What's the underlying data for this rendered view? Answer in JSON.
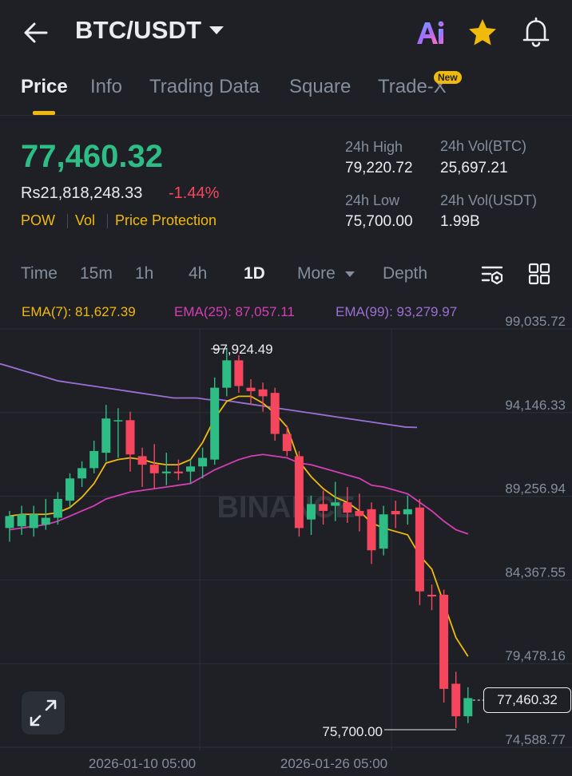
{
  "header": {
    "pair": "BTC/USDT",
    "icons": [
      "back-arrow-icon",
      "ai-icon",
      "star-icon",
      "bell-icon"
    ]
  },
  "tabs": [
    {
      "label": "Price",
      "active": true
    },
    {
      "label": "Info"
    },
    {
      "label": "Trading Data"
    },
    {
      "label": "Square"
    },
    {
      "label": "Trade-X",
      "badge": "New"
    }
  ],
  "ticker": {
    "last_price": "77,460.32",
    "fiat_price": "Rs21,818,248.33",
    "change_pct": "-1.44%",
    "tags": [
      "POW",
      "Vol",
      "Price Protection"
    ],
    "high_label": "24h High",
    "high_value": "79,220.72",
    "vol_btc_label": "24h Vol(BTC)",
    "vol_btc_value": "25,697.21",
    "low_label": "24h Low",
    "low_value": "75,700.00",
    "vol_usdt_label": "24h Vol(USDT)",
    "vol_usdt_value": "1.99B"
  },
  "timeframes": [
    {
      "label": "Time"
    },
    {
      "label": "15m"
    },
    {
      "label": "1h"
    },
    {
      "label": "4h"
    },
    {
      "label": "1D",
      "active": true
    },
    {
      "label": "More"
    },
    {
      "label": "Depth"
    }
  ],
  "ema_legend": {
    "ema7": "EMA(7): 81,627.39",
    "ema25": "EMA(25): 87,057.11",
    "ema99": "EMA(99): 93,279.97"
  },
  "colors": {
    "up": "#2ebd85",
    "down": "#f6465d",
    "ema7": "#f0b90b",
    "ema25": "#d63eb4",
    "ema99": "#9b6fd3",
    "accent": "#f0b90b"
  },
  "chart_data": {
    "type": "candlestick",
    "price_ticks": [
      "99,035.72",
      "94,146.33",
      "89,256.94",
      "84,367.55",
      "79,478.16",
      "74,588.77"
    ],
    "price_tick_values": [
      99035.72,
      94146.33,
      89256.94,
      84367.55,
      79478.16,
      74588.77
    ],
    "date_labels": [
      "2026-01-10 05:00",
      "2026-01-26 05:00"
    ],
    "max_label": "97,924.49",
    "min_label": "75,700.00",
    "last_price_label": "77,460.32",
    "watermark": "BINANCE",
    "candles": [
      {
        "o": 87400,
        "h": 88400,
        "l": 86600,
        "c": 88100
      },
      {
        "o": 87500,
        "h": 88700,
        "l": 87000,
        "c": 88200
      },
      {
        "o": 87400,
        "h": 88700,
        "l": 86900,
        "c": 88200
      },
      {
        "o": 87600,
        "h": 89100,
        "l": 87300,
        "c": 88000
      },
      {
        "o": 88000,
        "h": 89500,
        "l": 87600,
        "c": 89100
      },
      {
        "o": 89000,
        "h": 90600,
        "l": 88600,
        "c": 90300
      },
      {
        "o": 90300,
        "h": 91300,
        "l": 89800,
        "c": 90900
      },
      {
        "o": 90900,
        "h": 92500,
        "l": 90600,
        "c": 91900
      },
      {
        "o": 91800,
        "h": 94600,
        "l": 91300,
        "c": 93800
      },
      {
        "o": 93700,
        "h": 94400,
        "l": 91500,
        "c": 93700
      },
      {
        "o": 93700,
        "h": 94200,
        "l": 90700,
        "c": 91700
      },
      {
        "o": 91600,
        "h": 92100,
        "l": 89800,
        "c": 91100
      },
      {
        "o": 91100,
        "h": 92300,
        "l": 89700,
        "c": 90600
      },
      {
        "o": 90600,
        "h": 91800,
        "l": 89900,
        "c": 90700
      },
      {
        "o": 90700,
        "h": 91400,
        "l": 90200,
        "c": 90600
      },
      {
        "o": 90700,
        "h": 91400,
        "l": 90000,
        "c": 91000
      },
      {
        "o": 91000,
        "h": 92100,
        "l": 90300,
        "c": 91500
      },
      {
        "o": 91400,
        "h": 96200,
        "l": 91100,
        "c": 95600
      },
      {
        "o": 95600,
        "h": 97924.49,
        "l": 95100,
        "c": 97200
      },
      {
        "o": 97200,
        "h": 97500,
        "l": 95300,
        "c": 95700
      },
      {
        "o": 95600,
        "h": 96100,
        "l": 94600,
        "c": 95400
      },
      {
        "o": 95500,
        "h": 95900,
        "l": 94200,
        "c": 95100
      },
      {
        "o": 95300,
        "h": 95600,
        "l": 92500,
        "c": 92900
      },
      {
        "o": 92900,
        "h": 93400,
        "l": 91600,
        "c": 91900
      },
      {
        "o": 91600,
        "h": 91900,
        "l": 86900,
        "c": 87400
      },
      {
        "o": 87900,
        "h": 89300,
        "l": 87000,
        "c": 88800
      },
      {
        "o": 88800,
        "h": 89600,
        "l": 87600,
        "c": 88400
      },
      {
        "o": 88700,
        "h": 90100,
        "l": 87800,
        "c": 88900
      },
      {
        "o": 88900,
        "h": 89800,
        "l": 87700,
        "c": 88300
      },
      {
        "o": 88400,
        "h": 89400,
        "l": 87200,
        "c": 88100
      },
      {
        "o": 88500,
        "h": 88900,
        "l": 85300,
        "c": 86100
      },
      {
        "o": 86200,
        "h": 88700,
        "l": 85800,
        "c": 88200
      },
      {
        "o": 88400,
        "h": 89000,
        "l": 87400,
        "c": 88200
      },
      {
        "o": 88200,
        "h": 89300,
        "l": 87600,
        "c": 88500
      },
      {
        "o": 88600,
        "h": 89100,
        "l": 82900,
        "c": 83700
      },
      {
        "o": 83500,
        "h": 84100,
        "l": 82600,
        "c": 83400
      },
      {
        "o": 83500,
        "h": 83800,
        "l": 77200,
        "c": 78000
      },
      {
        "o": 78300,
        "h": 79000,
        "l": 75700,
        "c": 76400
      },
      {
        "o": 76400,
        "h": 78100,
        "l": 76000,
        "c": 77460.32
      }
    ],
    "ema7": [
      88100,
      88200,
      88200,
      88200,
      88300,
      88600,
      89200,
      90000,
      91200,
      91400,
      91500,
      91400,
      91200,
      91100,
      91100,
      91400,
      92400,
      93800,
      94800,
      95100,
      95100,
      94700,
      94100,
      93300,
      91300,
      90400,
      89700,
      89200,
      88900,
      88400,
      87700,
      87400,
      87200,
      87000,
      85800,
      85000,
      83000,
      81000,
      79900
    ],
    "ema25": [
      87300,
      87400,
      87500,
      87600,
      87800,
      88100,
      88400,
      88700,
      89100,
      89300,
      89500,
      89600,
      89700,
      89800,
      89900,
      90000,
      90400,
      90800,
      91100,
      91400,
      91600,
      91700,
      91600,
      91500,
      91200,
      91100,
      90900,
      90700,
      90500,
      90300,
      89900,
      89800,
      89600,
      89400,
      88900,
      88400,
      87800,
      87300,
      87057.11
    ],
    "ema99": [
      97000,
      96800,
      96600,
      96400,
      96200,
      96000,
      95900,
      95800,
      95700,
      95600,
      95500,
      95400,
      95300,
      95200,
      95100,
      95000,
      95000,
      95000,
      94900,
      94900,
      94800,
      94700,
      94600,
      94500,
      94400,
      94300,
      94200,
      94100,
      94000,
      93900,
      93800,
      93700,
      93600,
      93500,
      93400,
      93300,
      93279.97
    ]
  }
}
